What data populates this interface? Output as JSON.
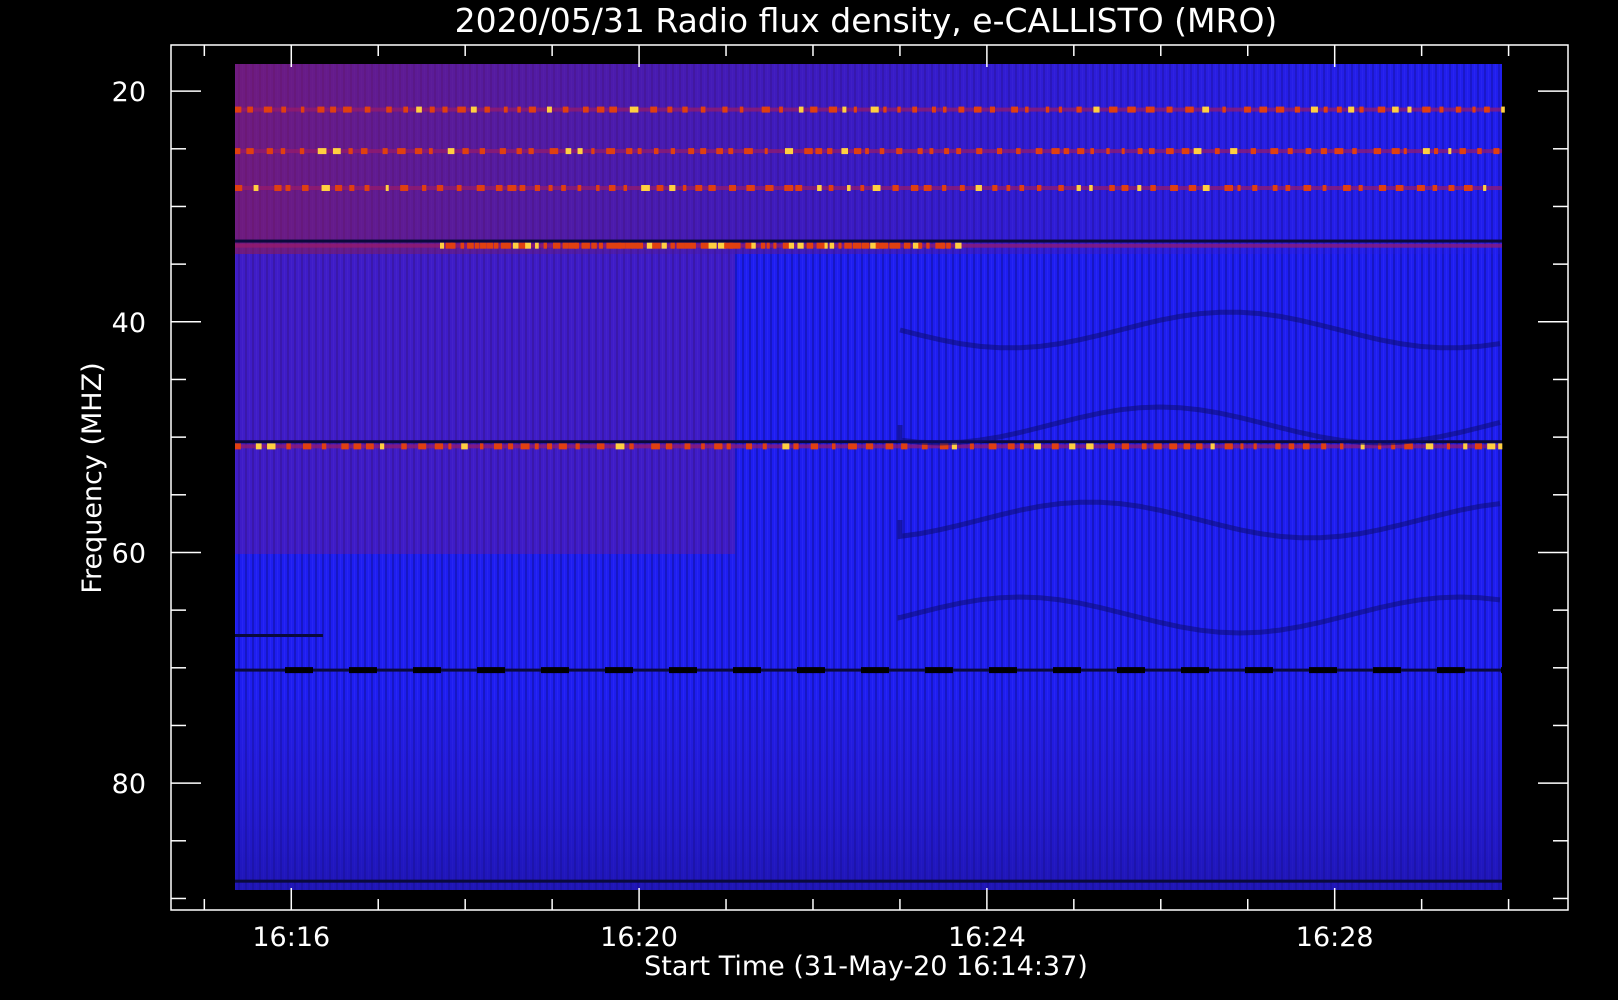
{
  "chart_data": {
    "type": "heatmap",
    "title": "2020/05/31  Radio flux density, e-CALLISTO (MRO)",
    "xlabel": "Start Time (31-May-20 16:14:37)",
    "ylabel": "Frequency (MHZ)",
    "x_ticks": [
      "16:16",
      "16:20",
      "16:24",
      "16:28"
    ],
    "x_tick_minutes": [
      16,
      20,
      24,
      28
    ],
    "x_range_minutes": [
      14.6167,
      30.6833
    ],
    "data_x_range_minutes": [
      15.1,
      30.1
    ],
    "y_ticks": [
      20,
      40,
      60,
      80
    ],
    "y_range": [
      16,
      91
    ],
    "data_y_range": [
      15.8,
      89.9
    ],
    "y_inverted": true,
    "grid": false,
    "colors": {
      "background": "#000000",
      "base": "#1e1ef0",
      "low": "#0a0a3c",
      "mid": "#9a1a6a",
      "high": "#e04010",
      "peak": "#ffd040",
      "axis": "#ffffff"
    },
    "bright_bands_mhz": [
      21.6,
      25.2,
      28.4,
      33.4,
      50.8
    ],
    "dark_bands_mhz": [
      33.0,
      50.4,
      67.2,
      70.2,
      88.5
    ]
  }
}
